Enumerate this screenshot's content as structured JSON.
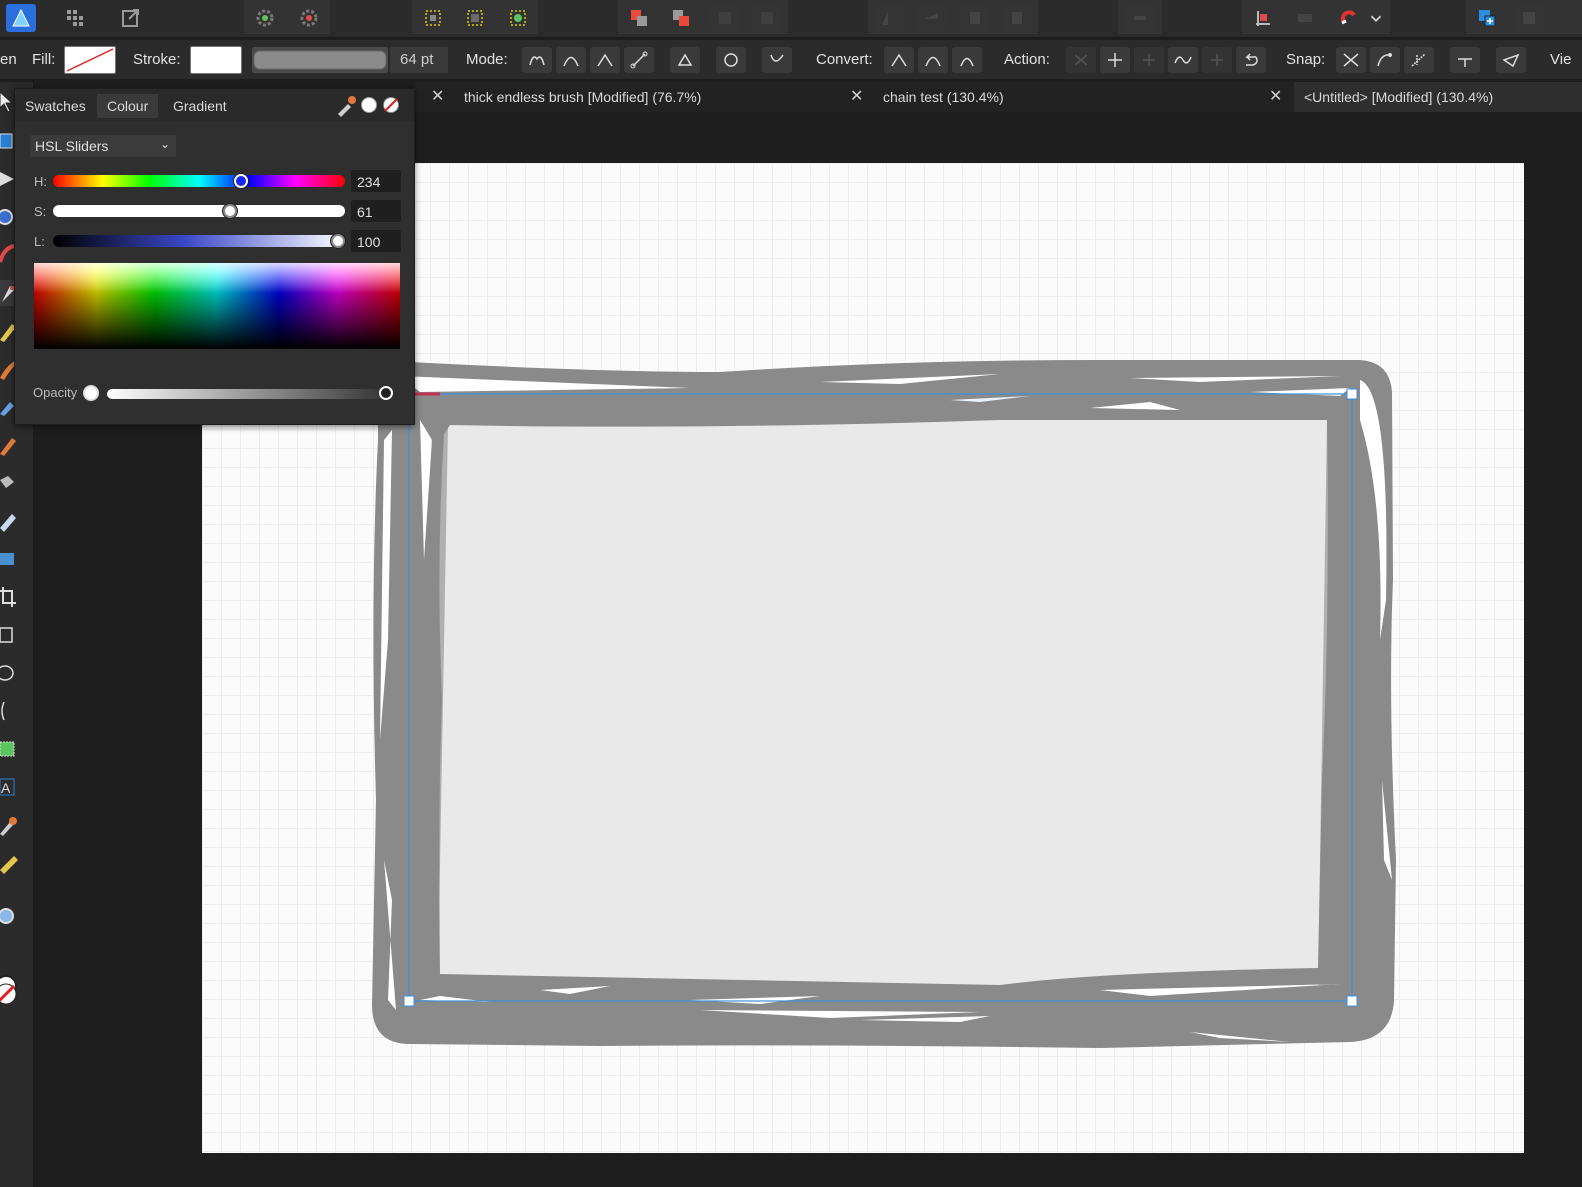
{
  "context_toolbar": {
    "left_cut": "en",
    "fill_label": "Fill:",
    "stroke_label": "Stroke:",
    "brush_size": "64 pt",
    "mode_label": "Mode:",
    "convert_label": "Convert:",
    "action_label": "Action:",
    "snap_label": "Snap:",
    "view_cut": "Vie"
  },
  "document_tabs": [
    {
      "title": "thick endless brush [Modified] (76.7%)"
    },
    {
      "title": "chain test (130.4%)"
    },
    {
      "title": "<Untitled> [Modified] (130.4%)"
    }
  ],
  "colour_panel": {
    "tabs": [
      "Swatches",
      "Colour",
      "Gradient"
    ],
    "active_tab": "Colour",
    "mode": "HSL Sliders",
    "sliders": [
      {
        "label": "H:",
        "value": "234",
        "fraction": 0.65
      },
      {
        "label": "S:",
        "value": "61",
        "fraction": 0.61
      },
      {
        "label": "L:",
        "value": "100",
        "fraction": 1.0
      }
    ],
    "opacity_label": "Opacity"
  },
  "colors": {
    "selection_blue": "#3b8fe0",
    "stroke_gray": "#8a8a8a",
    "hue_knob": "#1627ff"
  }
}
